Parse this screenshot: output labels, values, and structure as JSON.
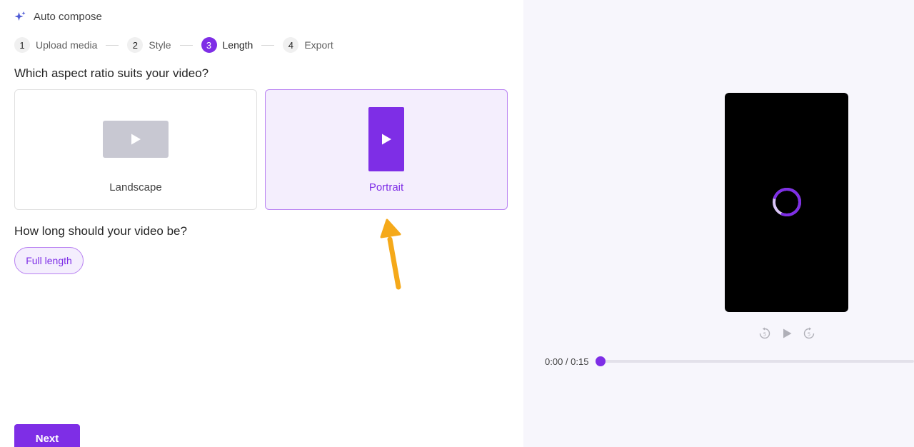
{
  "header": {
    "title": "Auto compose",
    "icon": "sparkle-icon"
  },
  "stepper": {
    "steps": [
      {
        "num": "1",
        "label": "Upload media"
      },
      {
        "num": "2",
        "label": "Style"
      },
      {
        "num": "3",
        "label": "Length"
      },
      {
        "num": "4",
        "label": "Export"
      }
    ],
    "active_step": "Length"
  },
  "aspect": {
    "question": "Which aspect ratio suits your video?",
    "options": [
      {
        "label": "Landscape",
        "icon": "play-icon"
      },
      {
        "label": "Portrait",
        "icon": "play-icon"
      }
    ],
    "selected": "Portrait"
  },
  "length": {
    "question": "How long should your video be?",
    "option": "Full length"
  },
  "actions": {
    "next_label": "Next"
  },
  "player": {
    "time_readout": "0:00 / 0:15",
    "progress": 0,
    "controls": [
      "rewind-5-icon",
      "play-icon",
      "forward-5-icon"
    ]
  },
  "colors": {
    "accent": "#7e2ee6",
    "accent_light": "#f4eefd",
    "annotation_arrow": "#f5a91a"
  }
}
